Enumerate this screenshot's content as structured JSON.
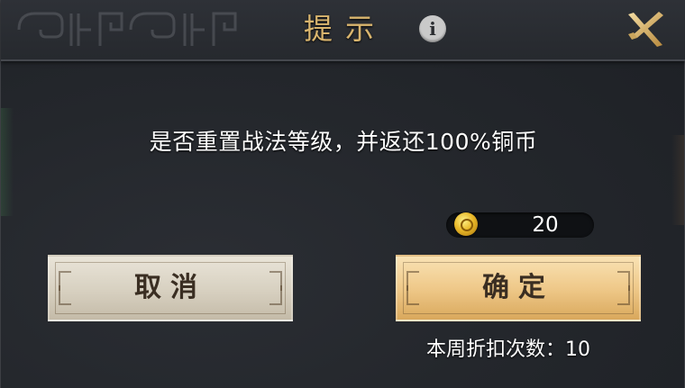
{
  "dialog": {
    "title": "提示",
    "message": "是否重置战法等级，并返还100%铜币"
  },
  "currency": {
    "icon": "copper-coin-icon",
    "amount": "20"
  },
  "buttons": {
    "cancel_label": "取消",
    "confirm_label": "确定"
  },
  "discount": {
    "text": "本周折扣次数：10"
  },
  "icons": {
    "info": "i",
    "close": "close-icon"
  },
  "colors": {
    "title": "#d9b56e",
    "cancel_button": "#dcd5c5",
    "confirm_button": "#efc98a"
  }
}
